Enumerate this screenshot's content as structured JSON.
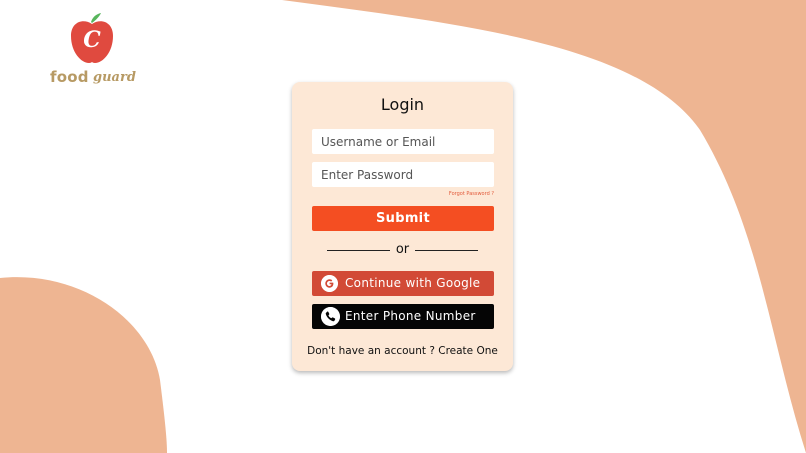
{
  "brand": {
    "name_part1": "food",
    "name_part2": "guard",
    "logo_letter": "C",
    "apple_color": "#e04a3f",
    "leaf_color": "#57b55c",
    "text_color": "#b79a64"
  },
  "background": {
    "shape_color": "#eeb592"
  },
  "login": {
    "title": "Login",
    "username_placeholder": "Username or Email",
    "password_placeholder": "Enter Password",
    "forgot_password": "Forgot Password ?",
    "submit_label": "Submit",
    "divider_text": "or",
    "google_label": "Continue with Google",
    "google_icon": "google-g-icon",
    "phone_label": "Enter Phone Number",
    "phone_icon": "phone-icon",
    "signup_prompt": "Don't have an account ?",
    "signup_link": "Create One",
    "card_color": "#fde8d6",
    "submit_color": "#f44e22",
    "google_color": "#d24a36",
    "phone_color": "#050505"
  }
}
